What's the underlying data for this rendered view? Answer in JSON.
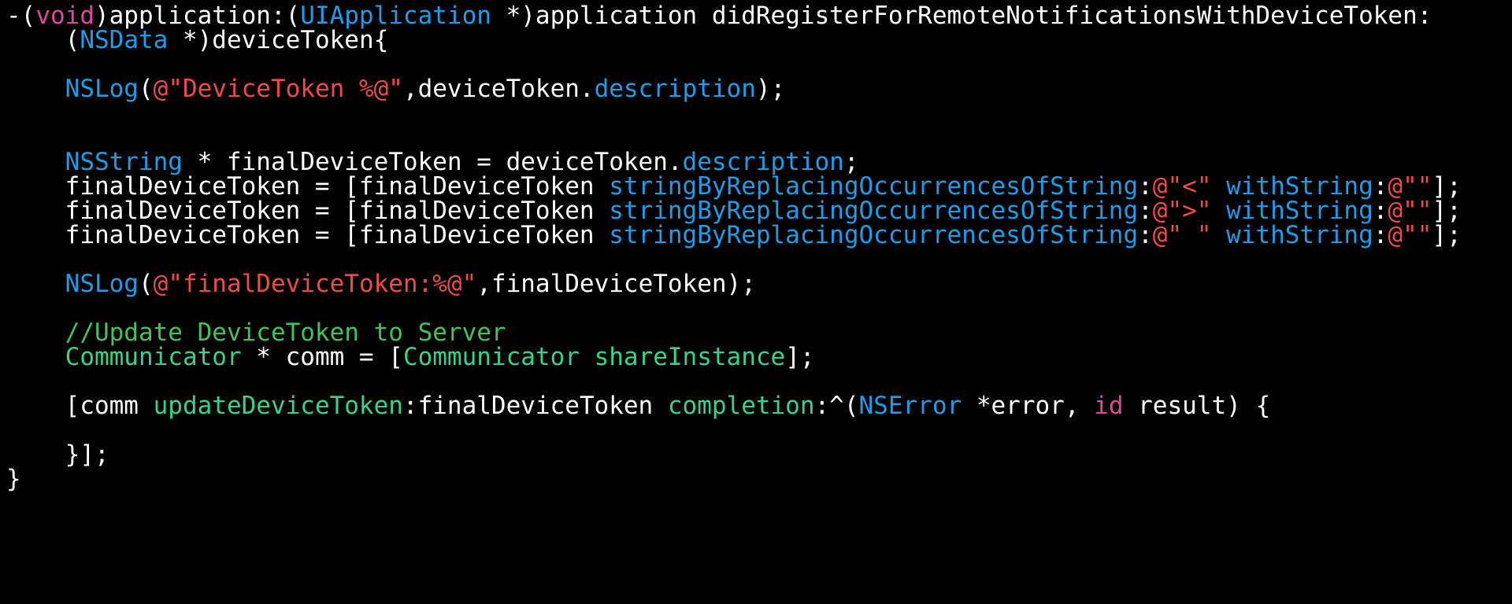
{
  "colors": {
    "background": "#000000",
    "plain": "#ffffff",
    "keyword": "#e0479e",
    "type": "#1d9de8",
    "string": "#ee4a4a",
    "comment": "#41c358",
    "project_symbol": "#33d58a"
  },
  "code": {
    "lines": [
      [
        {
          "text": "-(",
          "kind": "plain"
        },
        {
          "text": "void",
          "kind": "keyword"
        },
        {
          "text": ")application:(",
          "kind": "plain"
        },
        {
          "text": "UIApplication",
          "kind": "type"
        },
        {
          "text": " *)application didRegisterForRemoteNotificationsWithDeviceToken:",
          "kind": "plain"
        }
      ],
      [
        {
          "text": "    (",
          "kind": "plain"
        },
        {
          "text": "NSData",
          "kind": "type"
        },
        {
          "text": " *)deviceToken{",
          "kind": "plain"
        }
      ],
      [],
      [
        {
          "text": "    ",
          "kind": "plain"
        },
        {
          "text": "NSLog",
          "kind": "type"
        },
        {
          "text": "(",
          "kind": "plain"
        },
        {
          "text": "@\"DeviceToken %@\"",
          "kind": "string"
        },
        {
          "text": ",deviceToken.",
          "kind": "plain"
        },
        {
          "text": "description",
          "kind": "type"
        },
        {
          "text": ");",
          "kind": "plain"
        }
      ],
      [],
      [],
      [
        {
          "text": "    ",
          "kind": "plain"
        },
        {
          "text": "NSString",
          "kind": "type"
        },
        {
          "text": " * finalDeviceToken = deviceToken.",
          "kind": "plain"
        },
        {
          "text": "description",
          "kind": "type"
        },
        {
          "text": ";",
          "kind": "plain"
        }
      ],
      [
        {
          "text": "    finalDeviceToken = [finalDeviceToken ",
          "kind": "plain"
        },
        {
          "text": "stringByReplacingOccurrencesOfString",
          "kind": "type"
        },
        {
          "text": ":",
          "kind": "plain"
        },
        {
          "text": "@\"<\"",
          "kind": "string"
        },
        {
          "text": " ",
          "kind": "plain"
        },
        {
          "text": "withString",
          "kind": "type"
        },
        {
          "text": ":",
          "kind": "plain"
        },
        {
          "text": "@\"\"",
          "kind": "string"
        },
        {
          "text": "];",
          "kind": "plain"
        }
      ],
      [
        {
          "text": "    finalDeviceToken = [finalDeviceToken ",
          "kind": "plain"
        },
        {
          "text": "stringByReplacingOccurrencesOfString",
          "kind": "type"
        },
        {
          "text": ":",
          "kind": "plain"
        },
        {
          "text": "@\">\"",
          "kind": "string"
        },
        {
          "text": " ",
          "kind": "plain"
        },
        {
          "text": "withString",
          "kind": "type"
        },
        {
          "text": ":",
          "kind": "plain"
        },
        {
          "text": "@\"\"",
          "kind": "string"
        },
        {
          "text": "];",
          "kind": "plain"
        }
      ],
      [
        {
          "text": "    finalDeviceToken = [finalDeviceToken ",
          "kind": "plain"
        },
        {
          "text": "stringByReplacingOccurrencesOfString",
          "kind": "type"
        },
        {
          "text": ":",
          "kind": "plain"
        },
        {
          "text": "@\" \"",
          "kind": "string"
        },
        {
          "text": " ",
          "kind": "plain"
        },
        {
          "text": "withString",
          "kind": "type"
        },
        {
          "text": ":",
          "kind": "plain"
        },
        {
          "text": "@\"\"",
          "kind": "string"
        },
        {
          "text": "];",
          "kind": "plain"
        }
      ],
      [],
      [
        {
          "text": "    ",
          "kind": "plain"
        },
        {
          "text": "NSLog",
          "kind": "type"
        },
        {
          "text": "(",
          "kind": "plain"
        },
        {
          "text": "@\"finalDeviceToken:%@\"",
          "kind": "string"
        },
        {
          "text": ",finalDeviceToken);",
          "kind": "plain"
        }
      ],
      [],
      [
        {
          "text": "    ",
          "kind": "plain"
        },
        {
          "text": "//Update DeviceToken to Server",
          "kind": "comment"
        }
      ],
      [
        {
          "text": "    ",
          "kind": "plain"
        },
        {
          "text": "Communicator",
          "kind": "project_symbol"
        },
        {
          "text": " * comm = [",
          "kind": "plain"
        },
        {
          "text": "Communicator",
          "kind": "project_symbol"
        },
        {
          "text": " ",
          "kind": "plain"
        },
        {
          "text": "shareInstance",
          "kind": "project_symbol"
        },
        {
          "text": "];",
          "kind": "plain"
        }
      ],
      [],
      [
        {
          "text": "    [comm ",
          "kind": "plain"
        },
        {
          "text": "updateDeviceToken",
          "kind": "project_symbol"
        },
        {
          "text": ":finalDeviceToken ",
          "kind": "plain"
        },
        {
          "text": "completion",
          "kind": "project_symbol"
        },
        {
          "text": ":^(",
          "kind": "plain"
        },
        {
          "text": "NSError",
          "kind": "type"
        },
        {
          "text": " *error, ",
          "kind": "plain"
        },
        {
          "text": "id",
          "kind": "keyword"
        },
        {
          "text": " result) {",
          "kind": "plain"
        }
      ],
      [],
      [
        {
          "text": "    }];",
          "kind": "plain"
        }
      ],
      [
        {
          "text": "}",
          "kind": "plain"
        }
      ]
    ]
  }
}
